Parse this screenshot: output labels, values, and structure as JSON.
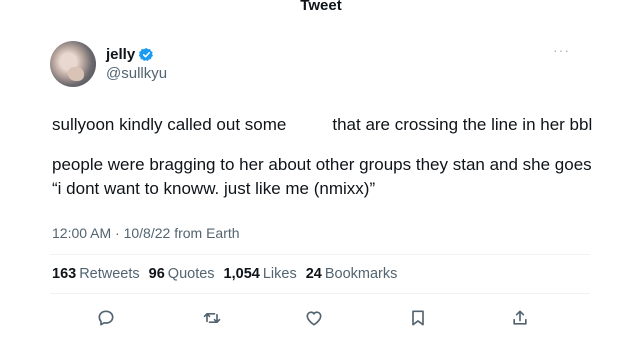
{
  "header": {
    "title": "Tweet"
  },
  "author": {
    "display_name": "jelly",
    "handle": "@sullkyu",
    "verified": true
  },
  "more_icon": "more-horizontal-icon",
  "tweet": {
    "line1_left": "sullyoon kindly called out some",
    "line1_right": "that are crossing the line in her bbl",
    "para2_line1": "people were bragging to her about other groups they stan and she goes",
    "para2_line2": "“i dont want to knoww. just like me (nmixx)”"
  },
  "timestamp": "12:00 AM · 10/8/22 from Earth",
  "stats": {
    "retweets_count": "163",
    "retweets_label": "Retweets",
    "quotes_count": "96",
    "quotes_label": "Quotes",
    "likes_count": "1,054",
    "likes_label": "Likes",
    "bookmarks_count": "24",
    "bookmarks_label": "Bookmarks"
  },
  "actions": [
    "reply-icon",
    "retweet-icon",
    "like-icon",
    "bookmark-icon",
    "share-icon"
  ],
  "colors": {
    "text": "#0f1419",
    "secondary": "#536471",
    "verified": "#1d9bf0",
    "divider": "#eff3f4"
  }
}
